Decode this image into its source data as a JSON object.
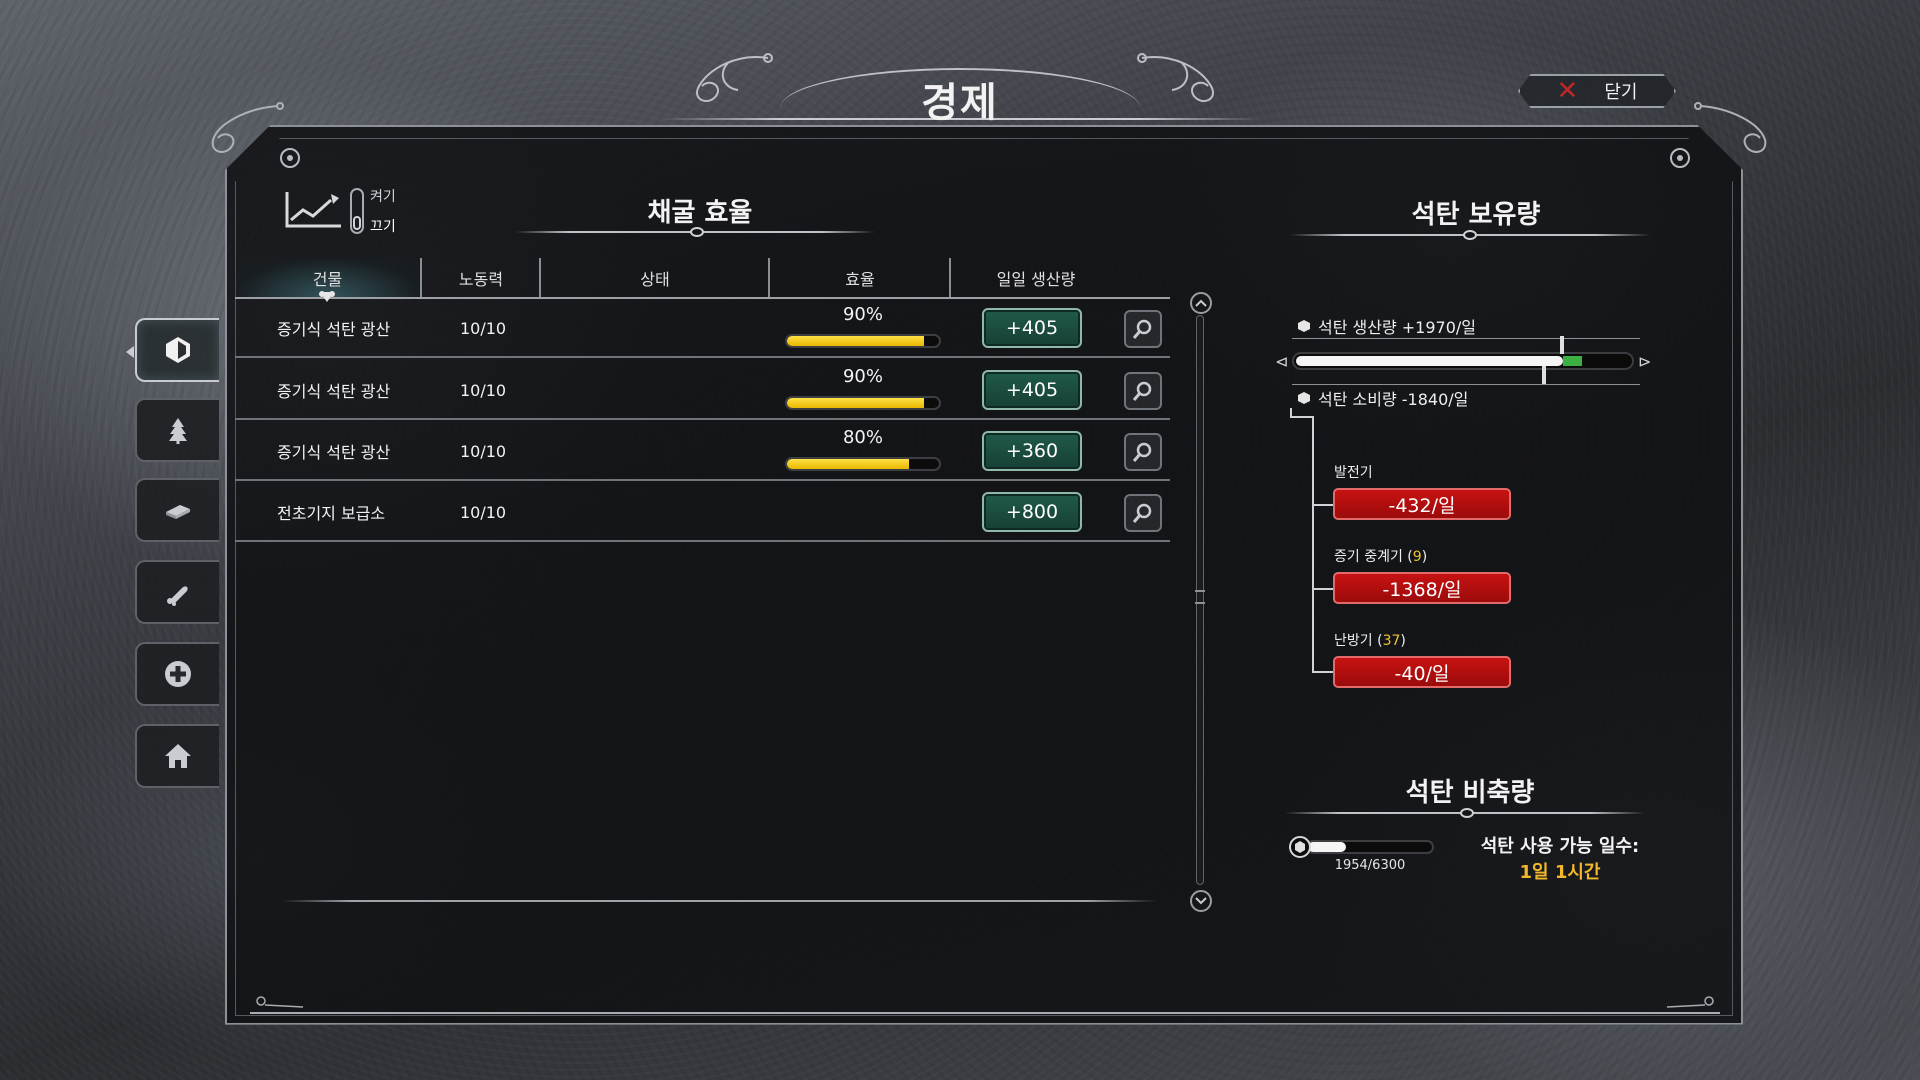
{
  "header": {
    "title": "경제",
    "close_label": "닫기"
  },
  "side_tabs": [
    {
      "icon": "coal-icon",
      "active": true
    },
    {
      "icon": "tree-icon",
      "active": false
    },
    {
      "icon": "steel-icon",
      "active": false
    },
    {
      "icon": "food-icon",
      "active": false
    },
    {
      "icon": "health-icon",
      "active": false
    },
    {
      "icon": "house-icon",
      "active": false
    }
  ],
  "toggle": {
    "on_label": "켜기",
    "off_label": "끄기"
  },
  "mining": {
    "heading": "채굴 효율",
    "columns": [
      "건물",
      "노동력",
      "상태",
      "효율",
      "일일 생산량"
    ],
    "rows": [
      {
        "building": "증기식 석탄 광산",
        "workforce": "10/10",
        "status": "",
        "efficiency": "90%",
        "efficiency_value": 0.9,
        "production": "+405"
      },
      {
        "building": "증기식 석탄 광산",
        "workforce": "10/10",
        "status": "",
        "efficiency": "90%",
        "efficiency_value": 0.9,
        "production": "+405"
      },
      {
        "building": "증기식 석탄 광산",
        "workforce": "10/10",
        "status": "",
        "efficiency": "80%",
        "efficiency_value": 0.8,
        "production": "+360"
      },
      {
        "building": "전초기지 보급소",
        "workforce": "10/10",
        "status": "",
        "efficiency": "",
        "efficiency_value": null,
        "production": "+800"
      }
    ]
  },
  "coal_stock": {
    "heading": "석탄 보유량",
    "production_label": "석탄 생산량 +1970/일",
    "consumption_label": "석탄 소비량 -1840/일",
    "consumers": [
      {
        "label": "발전기",
        "count": "",
        "value": "-432/일"
      },
      {
        "label": "증기 중계기",
        "count": "9",
        "value": "-1368/일"
      },
      {
        "label": "난방기",
        "count": "37",
        "value": "-40/일"
      }
    ]
  },
  "coal_reserve": {
    "heading": "석탄 비축량",
    "current": 1954,
    "capacity": 6300,
    "count_text": "1954/6300",
    "days_label": "석탄 사용 가능 일수:",
    "days_value": "1일 1시간"
  },
  "colors": {
    "efficiency_bar": "#ffd21f",
    "production_button": "#1f5a4a",
    "consumption_badge": "#c71212",
    "days_value": "#f2b72a"
  }
}
